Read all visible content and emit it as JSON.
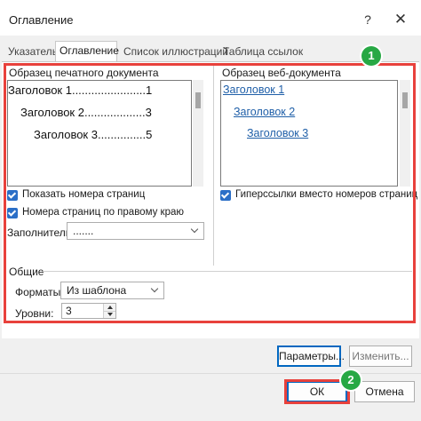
{
  "dialog": {
    "title": "Оглавление",
    "help": "?",
    "close": "✕"
  },
  "tabs": [
    {
      "label": "Указатель",
      "active": false
    },
    {
      "label": "Оглавление",
      "active": true
    },
    {
      "label": "Список иллюстраций",
      "active": false
    },
    {
      "label": "Таблица ссылок",
      "active": false
    }
  ],
  "print_preview": {
    "label": "Образец печатного документа",
    "lines": [
      {
        "text": "Заголовок 1.......................1"
      },
      {
        "text": "Заголовок 2...................3"
      },
      {
        "text": "Заголовок 3...............5"
      }
    ]
  },
  "web_preview": {
    "label": "Образец веб-документа",
    "links": [
      "Заголовок 1",
      "Заголовок 2",
      "Заголовок 3"
    ]
  },
  "options": {
    "show_page_numbers": {
      "label": "Показать номера страниц",
      "checked": true
    },
    "right_align": {
      "label": "Номера страниц по правому краю",
      "checked": true
    },
    "hyperlinks": {
      "label": "Гиперссылки вместо номеров страниц",
      "checked": true
    },
    "leader_label": "Заполнитель:",
    "leader_value": "......."
  },
  "general": {
    "label": "Общие",
    "formats_label": "Форматы:",
    "formats_value": "Из шаблона",
    "levels_label": "Уровни:",
    "levels_value": "3"
  },
  "buttons": {
    "params": "Параметры...",
    "modify": "Изменить...",
    "ok": "ОК",
    "cancel": "Отмена"
  },
  "annotations": {
    "badge1": "1",
    "badge2": "2",
    "color": "#e8413c",
    "badge_color": "#27a844"
  }
}
